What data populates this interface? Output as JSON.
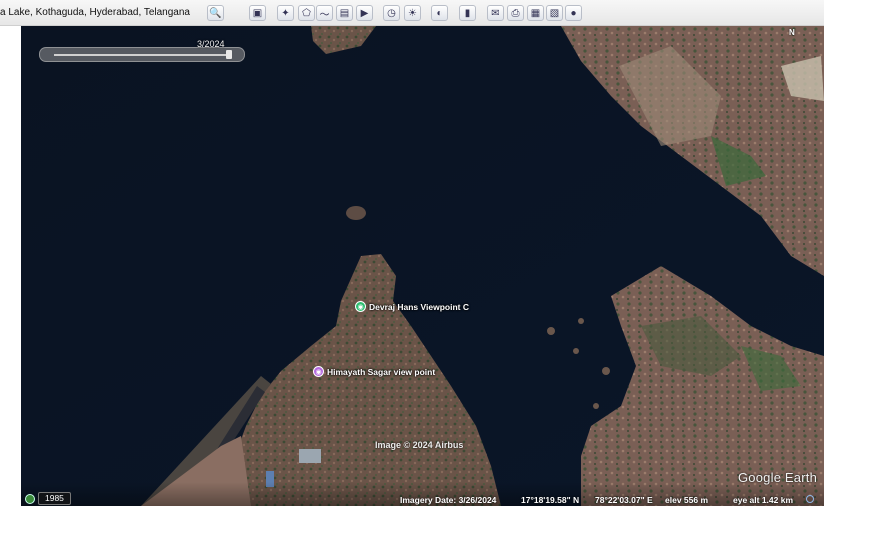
{
  "toolbar": {
    "search_text": "a Lake, Kothaguda, Hyderabad, Telangana",
    "buttons": [
      {
        "name": "search-button",
        "icon": "magnifier-icon",
        "glyph": "🔍"
      },
      {
        "name": "sidebar-toggle-button",
        "icon": "sidebar-icon",
        "glyph": "▣"
      },
      {
        "name": "add-placemark-button",
        "icon": "pushpin-icon",
        "glyph": "✦"
      },
      {
        "name": "add-polygon-button",
        "icon": "polygon-icon",
        "glyph": "⬠"
      },
      {
        "name": "add-path-button",
        "icon": "path-icon",
        "glyph": "〜"
      },
      {
        "name": "image-overlay-button",
        "icon": "overlay-icon",
        "glyph": "▤"
      },
      {
        "name": "record-tour-button",
        "icon": "tour-icon",
        "glyph": "▶"
      },
      {
        "name": "historical-imagery-button",
        "icon": "clock-icon",
        "glyph": "◷"
      },
      {
        "name": "sunlight-button",
        "icon": "sun-icon",
        "glyph": "☀"
      },
      {
        "name": "planets-button",
        "icon": "planet-icon",
        "glyph": "◐"
      },
      {
        "name": "ruler-button",
        "icon": "ruler-icon",
        "glyph": "▮"
      },
      {
        "name": "email-button",
        "icon": "envelope-icon",
        "glyph": "✉"
      },
      {
        "name": "print-button",
        "icon": "printer-icon",
        "glyph": "⎙"
      },
      {
        "name": "save-image-button",
        "icon": "save-image-icon",
        "glyph": "▦"
      },
      {
        "name": "view-in-maps-button",
        "icon": "maps-icon",
        "glyph": "▧"
      },
      {
        "name": "earth-gallery-button",
        "icon": "globe-icon",
        "glyph": "●"
      }
    ]
  },
  "map": {
    "time_slider_label": "3/2024",
    "compass": "N",
    "placemarks": [
      {
        "label": "Devraj Hans Viewpoint C",
        "icon": "viewpoint-pin-icon",
        "color": "#2fbf71"
      },
      {
        "label": "Himayath Sagar view point",
        "icon": "viewpoint-pin-icon",
        "color": "#b46be0"
      }
    ],
    "attribution": "Image © 2024 Airbus",
    "logo": "Google Earth"
  },
  "statusbar": {
    "historical_year": "1985",
    "imagery_date": "Imagery Date: 3/26/2024",
    "latitude": "17°18'19.58\" N",
    "longitude": "78°22'03.07\" E",
    "elevation": "elev   556 m",
    "eye_altitude": "eye alt   1.42 km"
  }
}
